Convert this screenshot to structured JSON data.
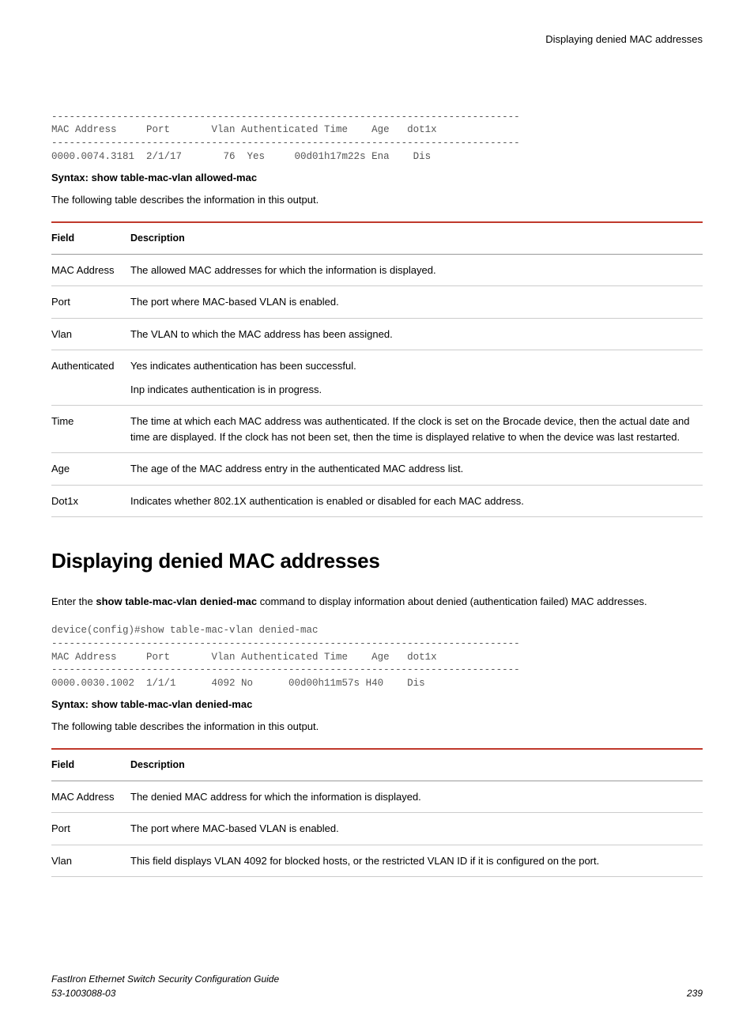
{
  "header": {
    "title": "Displaying denied MAC addresses"
  },
  "code1": "-------------------------------------------------------------------------------\nMAC Address     Port       Vlan Authenticated Time    Age   dot1x\n-------------------------------------------------------------------------------\n0000.0074.3181  2/1/17       76  Yes     00d01h17m22s Ena    Dis",
  "syntax1": "Syntax: show table-mac-vlan allowed-mac",
  "intro1": "The following table describes the information in this output.",
  "table1": {
    "head_field": "Field",
    "head_desc": "Description",
    "rows": [
      {
        "field": "MAC Address",
        "desc": [
          "The allowed MAC addresses for which the information is displayed."
        ]
      },
      {
        "field": "Port",
        "desc": [
          "The port where MAC-based VLAN is enabled."
        ]
      },
      {
        "field": "Vlan",
        "desc": [
          "The VLAN to which the MAC address has been assigned."
        ]
      },
      {
        "field": "Authenticated",
        "desc": [
          "Yes indicates authentication has been successful.",
          "Inp indicates authentication is in progress."
        ]
      },
      {
        "field": "Time",
        "desc": [
          "The time at which each MAC address was authenticated. If the clock is set on the Brocade device, then the actual date and time are displayed. If the clock has not been set, then the time is displayed relative to when the device was last restarted."
        ]
      },
      {
        "field": "Age",
        "desc": [
          "The age of the MAC address entry in the authenticated MAC address list."
        ]
      },
      {
        "field": "Dot1x",
        "desc": [
          "Indicates whether 802.1X authentication is enabled or disabled for each MAC address."
        ]
      }
    ]
  },
  "heading2": "Displaying denied MAC addresses",
  "para2_a": "Enter the ",
  "para2_bold": "show table-mac-vlan denied-mac",
  "para2_b": " command to display information about denied (authentication failed) MAC addresses.",
  "code2": "device(config)#show table-mac-vlan denied-mac\n-------------------------------------------------------------------------------\nMAC Address     Port       Vlan Authenticated Time    Age   dot1x\n-------------------------------------------------------------------------------\n0000.0030.1002  1/1/1      4092 No      00d00h11m57s H40    Dis",
  "syntax2": "Syntax: show table-mac-vlan denied-mac",
  "intro2": "The following table describes the information in this output.",
  "table2": {
    "head_field": "Field",
    "head_desc": "Description",
    "rows": [
      {
        "field": "MAC Address",
        "desc": [
          "The denied MAC address for which the information is displayed."
        ]
      },
      {
        "field": "Port",
        "desc": [
          "The port where MAC-based VLAN is enabled."
        ]
      },
      {
        "field": "Vlan",
        "desc": [
          "This field displays VLAN 4092 for blocked hosts, or the restricted VLAN ID if it is configured on the port."
        ]
      }
    ]
  },
  "footer": {
    "line1": "FastIron Ethernet Switch Security Configuration Guide",
    "line2": "53-1003088-03",
    "page": "239"
  }
}
